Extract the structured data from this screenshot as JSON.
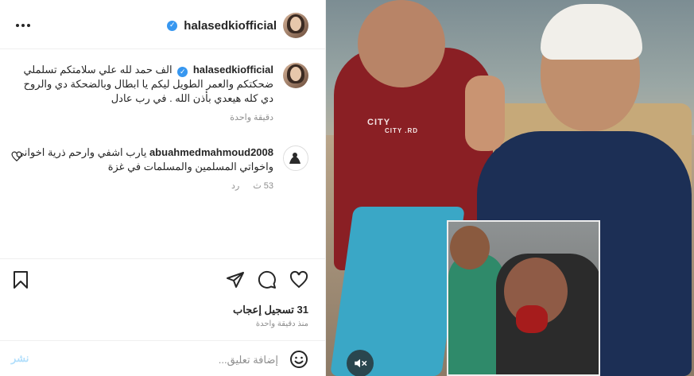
{
  "post": {
    "username": "halasedkiofficial",
    "more_label": "...",
    "caption": {
      "username": "halasedkiofficial",
      "text": "الف حمد لله علي سلامتكم تسلملي ضحكتكم والعمر الطويل ليكم يا ابطال وبالضحكة دي والروح دي كله هيعدي بأذن الله . في رب عادل",
      "time": "دقيقة واحدة"
    },
    "comments": [
      {
        "username": "abuahmedmahmoud2008",
        "text": "يارب اشفي وارحم ذرية اخواني واخواتي المسلمين والمسلمات في غزة",
        "time": "53 ث",
        "reply_label": "رد"
      }
    ],
    "likes_text": "31 تسجيل إعجاب",
    "posted_ago": "منذ دقيقة واحدة",
    "comment_input": {
      "placeholder": "إضافة تعليق...",
      "post_label": "نشر"
    }
  },
  "media": {
    "shirt_text": "CITY",
    "shirt_subtext": "CITY .RD"
  },
  "colors": {
    "verified": "#3797f0",
    "muted_text": "#8e8e8e",
    "post_button_disabled": "#b2dffc"
  }
}
